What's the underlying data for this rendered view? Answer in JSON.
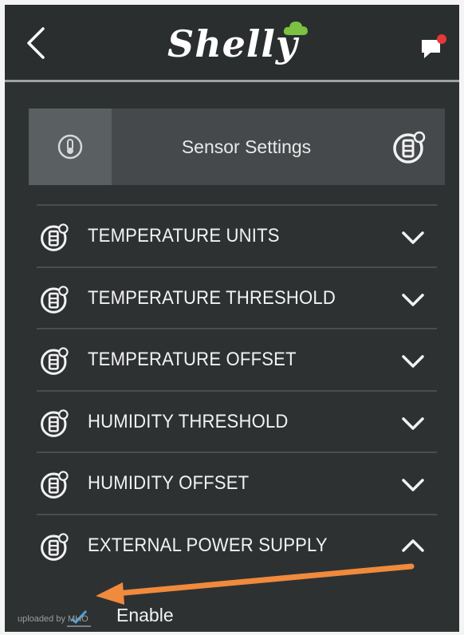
{
  "header": {
    "brand": "Shelly",
    "back_icon": "chevron-left-icon",
    "chat_icon": "chat-notification-icon",
    "colors": {
      "brand_cloud": "#7cc142",
      "notification_dot": "#e53935"
    }
  },
  "sensor_bar": {
    "title": "Sensor Settings",
    "left_icon": "thermometer-icon",
    "right_icon": "sensor-settings-icon"
  },
  "sections": [
    {
      "label": "TEMPERATURE UNITS",
      "expanded": false
    },
    {
      "label": "TEMPERATURE THRESHOLD",
      "expanded": false
    },
    {
      "label": "TEMPERATURE OFFSET",
      "expanded": false
    },
    {
      "label": "HUMIDITY THRESHOLD",
      "expanded": false
    },
    {
      "label": "HUMIDITY OFFSET",
      "expanded": false
    },
    {
      "label": "EXTERNAL POWER SUPPLY",
      "expanded": true
    }
  ],
  "enable": {
    "label": "Enable",
    "checked": true
  },
  "watermark": "uploaded by MHO",
  "annotation": {
    "arrow_color": "#f08a3c"
  }
}
